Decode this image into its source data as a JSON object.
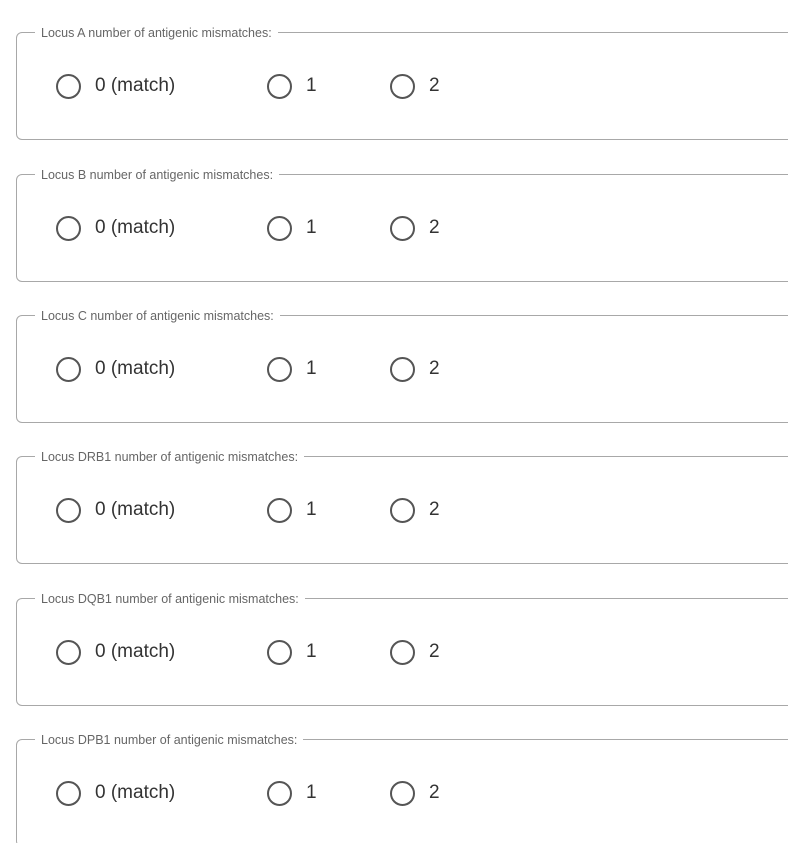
{
  "loci": [
    {
      "legend": "Locus A number of antigenic mismatches:",
      "options": [
        {
          "label": "0 (match)",
          "selected": false
        },
        {
          "label": "1",
          "selected": false
        },
        {
          "label": "2",
          "selected": false
        }
      ]
    },
    {
      "legend": "Locus B number of antigenic mismatches:",
      "options": [
        {
          "label": "0 (match)",
          "selected": false
        },
        {
          "label": "1",
          "selected": false
        },
        {
          "label": "2",
          "selected": false
        }
      ]
    },
    {
      "legend": "Locus C number of antigenic mismatches:",
      "options": [
        {
          "label": "0 (match)",
          "selected": false
        },
        {
          "label": "1",
          "selected": false
        },
        {
          "label": "2",
          "selected": false
        }
      ]
    },
    {
      "legend": "Locus DRB1 number of antigenic mismatches:",
      "options": [
        {
          "label": "0 (match)",
          "selected": false
        },
        {
          "label": "1",
          "selected": false
        },
        {
          "label": "2",
          "selected": false
        }
      ]
    },
    {
      "legend": "Locus DQB1 number of antigenic mismatches:",
      "options": [
        {
          "label": "0 (match)",
          "selected": false
        },
        {
          "label": "1",
          "selected": false
        },
        {
          "label": "2",
          "selected": false
        }
      ]
    },
    {
      "legend": "Locus DPB1 number of antigenic mismatches:",
      "options": [
        {
          "label": "0 (match)",
          "selected": false
        },
        {
          "label": "1",
          "selected": false
        },
        {
          "label": "2",
          "selected": false
        }
      ]
    }
  ],
  "colors": {
    "border": "#a8a8a8",
    "legend_text": "#666666",
    "radio_ring": "#555555",
    "label_text": "#333333",
    "background": "#ffffff"
  }
}
